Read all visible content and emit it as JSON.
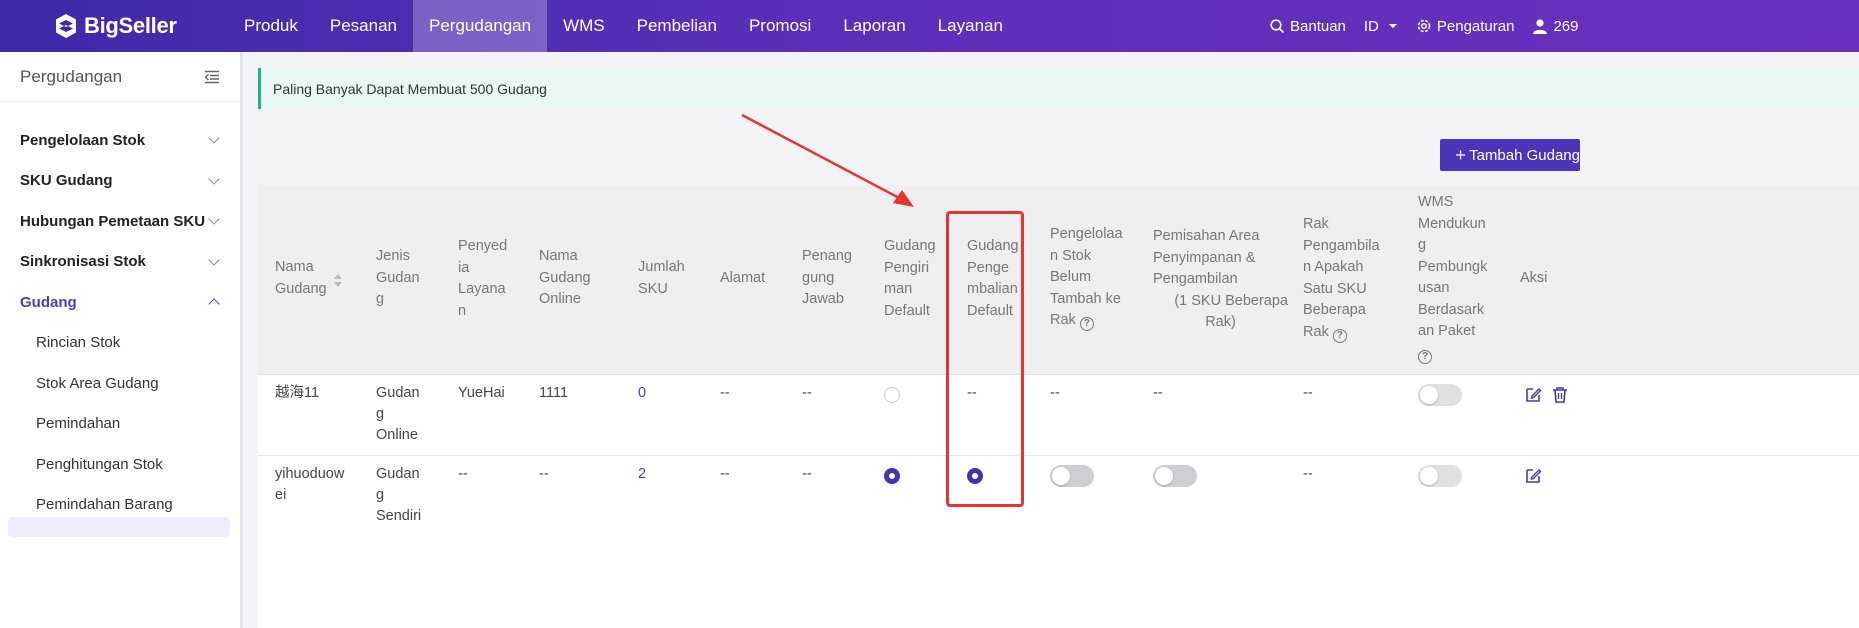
{
  "topbar": {
    "logo_text": "BigSeller",
    "nav": [
      "Produk",
      "Pesanan",
      "Pergudangan",
      "WMS",
      "Pembelian",
      "Promosi",
      "Laporan",
      "Layanan"
    ],
    "active_nav": "Pergudangan",
    "help_label": "Bantuan",
    "language": "ID",
    "settings_label": "Pengaturan",
    "user_label": "269"
  },
  "sidebar": {
    "title": "Pergudangan",
    "groups": [
      {
        "label": "Pengelolaan Stok"
      },
      {
        "label": "SKU Gudang"
      },
      {
        "label": "Hubungan Pemetaan SKU"
      },
      {
        "label": "Sinkronisasi Stok"
      },
      {
        "label": "Gudang"
      }
    ],
    "subitems": [
      "Rincian Stok",
      "Stok Area Gudang",
      "Pemindahan",
      "Penghitungan Stok",
      "Pemindahan Barang"
    ]
  },
  "notice": "Paling Banyak Dapat Membuat 500 Gudang",
  "add_button": "Tambah Gudang",
  "table": {
    "headers": {
      "nama_gudang": [
        "Nama",
        "Gudang"
      ],
      "jenis": [
        "Jenis",
        "Gudan",
        "g"
      ],
      "penyedia": [
        "Penyed",
        "ia",
        "Layana",
        "n"
      ],
      "nama_online": [
        "Nama",
        "Gudang",
        "Online"
      ],
      "jumlah": [
        "Jumlah",
        "SKU"
      ],
      "alamat": [
        "Alamat"
      ],
      "penanggung": [
        "Penang",
        "gung",
        "Jawab"
      ],
      "pengiriman": [
        "Gudang",
        "Pengiri",
        "man",
        "Default"
      ],
      "pengembalian": [
        "Gudang",
        "Penge",
        "mbalian",
        "Default"
      ],
      "pengelolaan": [
        "Pengelolaa",
        "n Stok",
        "Belum",
        "Tambah ke",
        "Rak"
      ],
      "pemisahan": [
        "Pemisahan Area",
        "Penyimpanan &",
        "Pengambilan",
        "(1 SKU Beberapa",
        "Rak)"
      ],
      "rak": [
        "Rak",
        "Pengambila",
        "n Apakah",
        "Satu SKU",
        "Beberapa",
        "Rak"
      ],
      "wms": [
        "WMS",
        "Mendukun",
        "g",
        "Pembungk",
        "usan",
        "Berdasark",
        "an Paket"
      ],
      "aksi": [
        "Aksi"
      ]
    },
    "rows": [
      {
        "nama": "越海11",
        "jenis": [
          "Gudan",
          "g",
          "Online"
        ],
        "penyedia": "YueHai",
        "nama_online": "1111",
        "jumlah": "0",
        "alamat": "--",
        "penanggung": "--",
        "pengembalian": "--",
        "pengelolaan": "--",
        "pemisahan": "--",
        "rak": "--"
      },
      {
        "nama": [
          "yihuoduow",
          "ei"
        ],
        "jenis": [
          "Gudan",
          "g",
          "Sendiri"
        ],
        "penyedia": "--",
        "nama_online": "--",
        "jumlah": "2",
        "alamat": "--",
        "penanggung": "--",
        "rak": "--"
      }
    ]
  },
  "colors": {
    "primary": "#4c35b8",
    "highlight": "#e8332f",
    "notice_border": "#1fb38a"
  }
}
